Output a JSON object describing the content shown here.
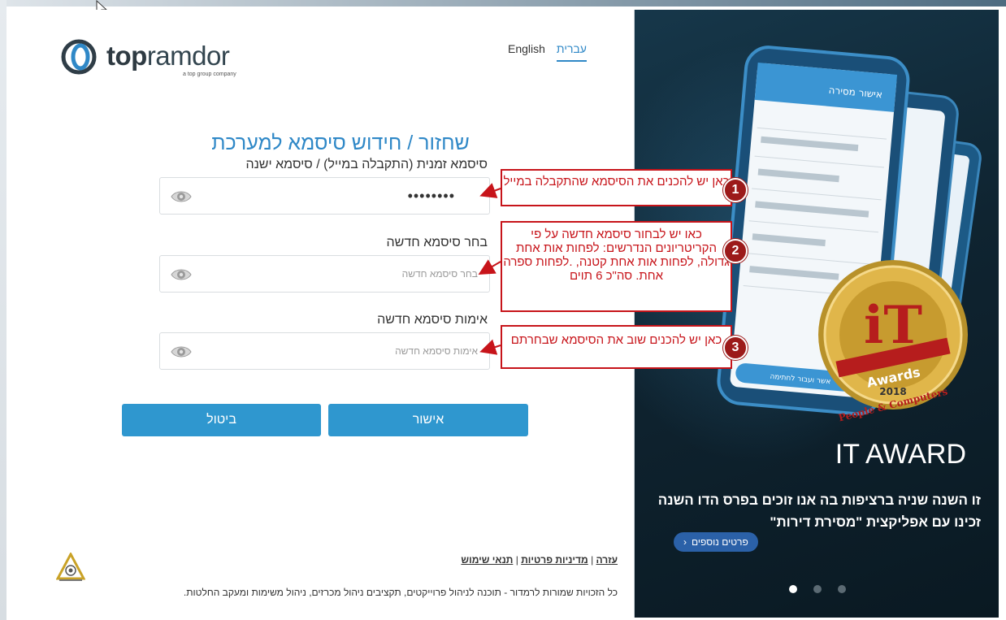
{
  "header": {
    "logo_text_bold": "top",
    "logo_text_light": "ramdor",
    "logo_subtitle": "a top group company",
    "lang_english": "English",
    "lang_hebrew": "עברית"
  },
  "form": {
    "title": "שחזור / חידוש סיסמא למערכת",
    "temp_password_label": "סיסמא זמנית (התקבלה במייל) / סיסמא ישנה",
    "temp_password_value": "••••••••",
    "new_password_label": "בחר סיסמא חדשה",
    "new_password_placeholder": "בחר סיסמא חדשה",
    "confirm_password_label": "אימות סיסמא חדשה",
    "confirm_password_placeholder": "אימות סיסמא חדשה",
    "confirm_button": "אישור",
    "cancel_button": "ביטול"
  },
  "annotations": [
    {
      "number": "1",
      "text": "כאן יש להכנים את הסיסמא שהתקבלה במייל"
    },
    {
      "number": "2",
      "text": "כאו יש לבחור סיסמא חדשה על פי הקריטריונים הנדרשים: לפחות אות אחת גדולה, לפחות אות אחת קטנה, .לפחות ספרה אחת. סה\"כ 6 תוים"
    },
    {
      "number": "3",
      "text": "כאן יש להכנים שוב את הסיסמא שבחרתם"
    }
  ],
  "footer": {
    "help_link": "עזרה",
    "privacy_link": "מדיניות פרטיות",
    "terms_link": "תנאי שימוש",
    "separator": "|",
    "copyright": "כל הזכויות שמורות לרמדור - תוכנה לניהול פרוייקטים, תקציבים ניהול מכרזים, ניהול משימות ומעקב החלטות."
  },
  "promo": {
    "title": "IT AWARD",
    "text": "זו השנה שניה ברציפות בה אנו זוכים בפרס הדו השנה זכינו עם אפליקצית \"מסירת דירות\"",
    "more_button": "פרטים נוספים",
    "award_text_main": "Awards",
    "award_year": "2018",
    "award_banner": "People & Computers",
    "phone_header": "אישור מסירה",
    "phone_button": "אשר ועבור לחתימה",
    "carousel_count": 3,
    "carousel_active": 1
  },
  "colors": {
    "accent": "#2f88c7",
    "button": "#2f97cf",
    "annotation": "#c7141a",
    "promo_bg": "#0f2431"
  }
}
